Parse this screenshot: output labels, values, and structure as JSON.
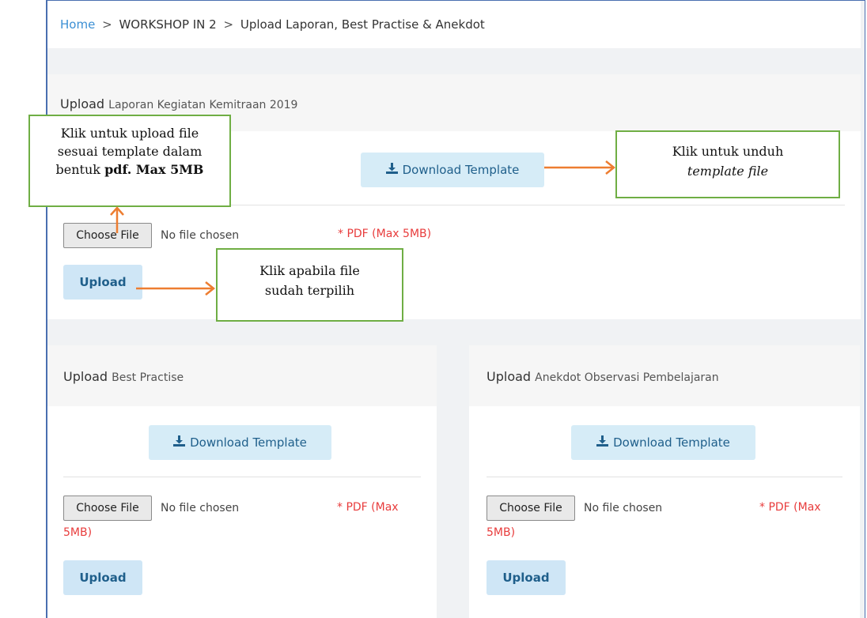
{
  "breadcrumb": {
    "home": "Home",
    "separator": ">",
    "level1": "WORKSHOP IN 2",
    "level2": "Upload Laporan, Best Practise & Anekdot"
  },
  "upload_word": "Upload",
  "icons": {
    "download": "download-icon",
    "arrow": "arrow-icon"
  },
  "colors": {
    "callout_border": "#6fae44",
    "arrow": "#ed7d31",
    "required_text": "#e83c3c",
    "link": "#3b8fd4",
    "button_bg": "#d6ecf7"
  },
  "sections": {
    "laporan": {
      "title": "Laporan Kegiatan Kemitraan 2019",
      "download_label": "Download Template",
      "choose_file": "Choose File",
      "no_file": "No file chosen",
      "requirement": "* PDF (Max 5MB)",
      "upload_label": "Upload"
    },
    "best": {
      "title": "Best Practise",
      "download_label": "Download Template",
      "choose_file": "Choose File",
      "no_file": "No file chosen",
      "requirement_1": "* PDF (Max",
      "requirement_2": "5MB)",
      "upload_label": "Upload"
    },
    "anekdot": {
      "title": "Anekdot Observasi Pembelajaran",
      "download_label": "Download Template",
      "choose_file": "Choose File",
      "no_file": "No file chosen",
      "requirement_1": "* PDF (Max",
      "requirement_2": "5MB)",
      "upload_label": "Upload"
    }
  },
  "callouts": {
    "upload_file": {
      "line1": "Klik untuk upload file",
      "line2": "sesuai template dalam",
      "line3_prefix": "bentuk ",
      "line3_bold": "pdf. Max 5MB"
    },
    "download": {
      "line1": "Klik untuk unduh",
      "line2": "template file"
    },
    "upload_btn": {
      "line1": "Klik apabila file",
      "line2": "sudah terpilih"
    }
  }
}
